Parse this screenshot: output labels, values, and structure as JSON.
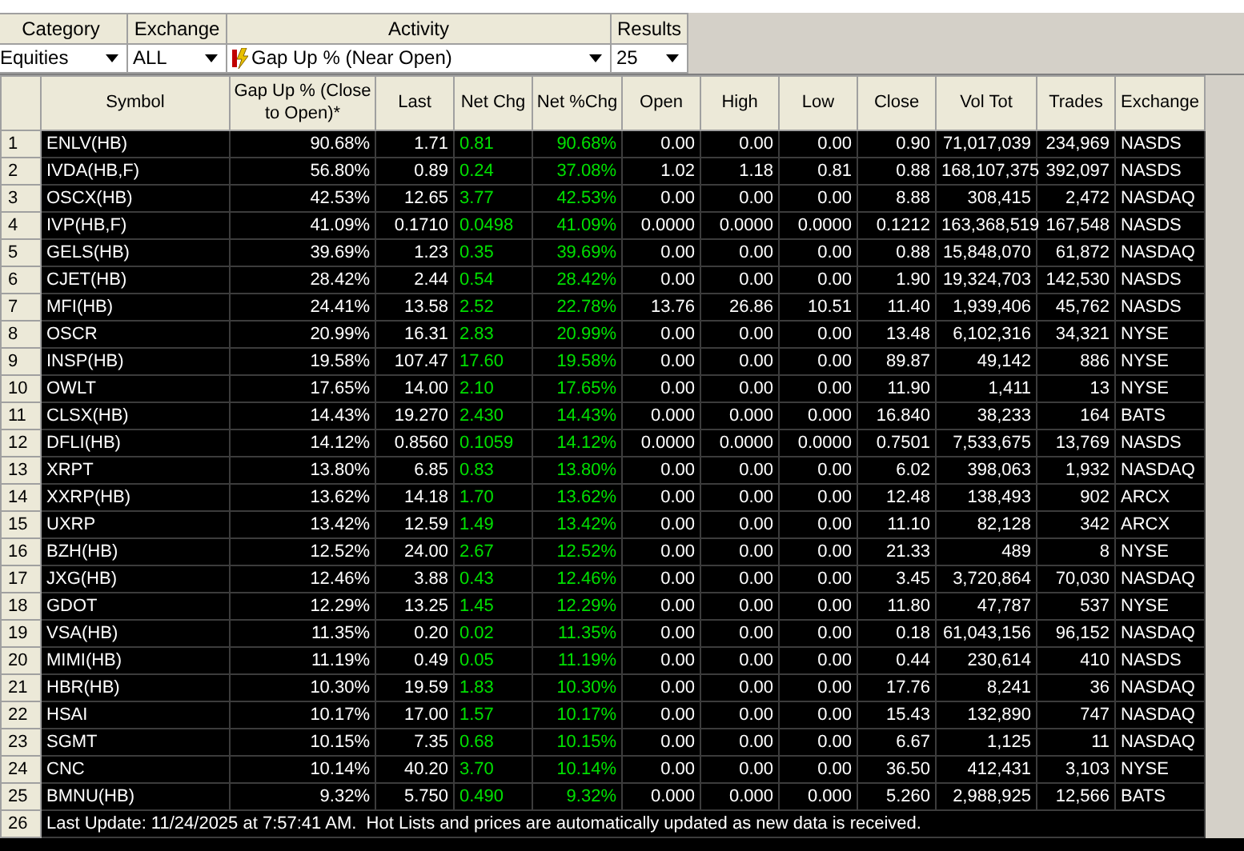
{
  "filters": [
    {
      "label": "Category",
      "value": "Equities",
      "icon": false
    },
    {
      "label": "Exchange",
      "value": "ALL",
      "icon": false
    },
    {
      "label": "Activity",
      "value": "Gap Up % (Near Open)",
      "icon": true
    },
    {
      "label": "Results",
      "value": "25",
      "icon": false
    }
  ],
  "table": {
    "columns": [
      "",
      "Symbol",
      "Gap Up % (Close to Open)*",
      "Last",
      "Net Chg",
      "Net %Chg",
      "Open",
      "High",
      "Low",
      "Close",
      "Vol Tot",
      "Trades",
      "Exchange"
    ],
    "rows": [
      [
        "1",
        "ENLV(HB)",
        "90.68%",
        "1.71",
        "0.81",
        "90.68%",
        "0.00",
        "0.00",
        "0.00",
        "0.90",
        "71,017,039",
        "234,969",
        "NASDS"
      ],
      [
        "2",
        "IVDA(HB,F)",
        "56.80%",
        "0.89",
        "0.24",
        "37.08%",
        "1.02",
        "1.18",
        "0.81",
        "0.88",
        "168,107,375",
        "392,097",
        "NASDS"
      ],
      [
        "3",
        "OSCX(HB)",
        "42.53%",
        "12.65",
        "3.77",
        "42.53%",
        "0.00",
        "0.00",
        "0.00",
        "8.88",
        "308,415",
        "2,472",
        "NASDAQ"
      ],
      [
        "4",
        "IVP(HB,F)",
        "41.09%",
        "0.1710",
        "0.0498",
        "41.09%",
        "0.0000",
        "0.0000",
        "0.0000",
        "0.1212",
        "163,368,519",
        "167,548",
        "NASDS"
      ],
      [
        "5",
        "GELS(HB)",
        "39.69%",
        "1.23",
        "0.35",
        "39.69%",
        "0.00",
        "0.00",
        "0.00",
        "0.88",
        "15,848,070",
        "61,872",
        "NASDAQ"
      ],
      [
        "6",
        "CJET(HB)",
        "28.42%",
        "2.44",
        "0.54",
        "28.42%",
        "0.00",
        "0.00",
        "0.00",
        "1.90",
        "19,324,703",
        "142,530",
        "NASDS"
      ],
      [
        "7",
        "MFI(HB)",
        "24.41%",
        "13.58",
        "2.52",
        "22.78%",
        "13.76",
        "26.86",
        "10.51",
        "11.40",
        "1,939,406",
        "45,762",
        "NASDS"
      ],
      [
        "8",
        "OSCR",
        "20.99%",
        "16.31",
        "2.83",
        "20.99%",
        "0.00",
        "0.00",
        "0.00",
        "13.48",
        "6,102,316",
        "34,321",
        "NYSE"
      ],
      [
        "9",
        "INSP(HB)",
        "19.58%",
        "107.47",
        "17.60",
        "19.58%",
        "0.00",
        "0.00",
        "0.00",
        "89.87",
        "49,142",
        "886",
        "NYSE"
      ],
      [
        "10",
        "OWLT",
        "17.65%",
        "14.00",
        "2.10",
        "17.65%",
        "0.00",
        "0.00",
        "0.00",
        "11.90",
        "1,411",
        "13",
        "NYSE"
      ],
      [
        "11",
        "CLSX(HB)",
        "14.43%",
        "19.270",
        "2.430",
        "14.43%",
        "0.000",
        "0.000",
        "0.000",
        "16.840",
        "38,233",
        "164",
        "BATS"
      ],
      [
        "12",
        "DFLI(HB)",
        "14.12%",
        "0.8560",
        "0.1059",
        "14.12%",
        "0.0000",
        "0.0000",
        "0.0000",
        "0.7501",
        "7,533,675",
        "13,769",
        "NASDS"
      ],
      [
        "13",
        "XRPT",
        "13.80%",
        "6.85",
        "0.83",
        "13.80%",
        "0.00",
        "0.00",
        "0.00",
        "6.02",
        "398,063",
        "1,932",
        "NASDAQ"
      ],
      [
        "14",
        "XXRP(HB)",
        "13.62%",
        "14.18",
        "1.70",
        "13.62%",
        "0.00",
        "0.00",
        "0.00",
        "12.48",
        "138,493",
        "902",
        "ARCX"
      ],
      [
        "15",
        "UXRP",
        "13.42%",
        "12.59",
        "1.49",
        "13.42%",
        "0.00",
        "0.00",
        "0.00",
        "11.10",
        "82,128",
        "342",
        "ARCX"
      ],
      [
        "16",
        "BZH(HB)",
        "12.52%",
        "24.00",
        "2.67",
        "12.52%",
        "0.00",
        "0.00",
        "0.00",
        "21.33",
        "489",
        "8",
        "NYSE"
      ],
      [
        "17",
        "JXG(HB)",
        "12.46%",
        "3.88",
        "0.43",
        "12.46%",
        "0.00",
        "0.00",
        "0.00",
        "3.45",
        "3,720,864",
        "70,030",
        "NASDAQ"
      ],
      [
        "18",
        "GDOT",
        "12.29%",
        "13.25",
        "1.45",
        "12.29%",
        "0.00",
        "0.00",
        "0.00",
        "11.80",
        "47,787",
        "537",
        "NYSE"
      ],
      [
        "19",
        "VSA(HB)",
        "11.35%",
        "0.20",
        "0.02",
        "11.35%",
        "0.00",
        "0.00",
        "0.00",
        "0.18",
        "61,043,156",
        "96,152",
        "NASDAQ"
      ],
      [
        "20",
        "MIMI(HB)",
        "11.19%",
        "0.49",
        "0.05",
        "11.19%",
        "0.00",
        "0.00",
        "0.00",
        "0.44",
        "230,614",
        "410",
        "NASDS"
      ],
      [
        "21",
        "HBR(HB)",
        "10.30%",
        "19.59",
        "1.83",
        "10.30%",
        "0.00",
        "0.00",
        "0.00",
        "17.76",
        "8,241",
        "36",
        "NASDAQ"
      ],
      [
        "22",
        "HSAI",
        "10.17%",
        "17.00",
        "1.57",
        "10.17%",
        "0.00",
        "0.00",
        "0.00",
        "15.43",
        "132,890",
        "747",
        "NASDAQ"
      ],
      [
        "23",
        "SGMT",
        "10.15%",
        "7.35",
        "0.68",
        "10.15%",
        "0.00",
        "0.00",
        "0.00",
        "6.67",
        "1,125",
        "11",
        "NASDAQ"
      ],
      [
        "24",
        "CNC",
        "10.14%",
        "40.20",
        "3.70",
        "10.14%",
        "0.00",
        "0.00",
        "0.00",
        "36.50",
        "412,431",
        "3,103",
        "NYSE"
      ],
      [
        "25",
        "BMNU(HB)",
        "9.32%",
        "5.750",
        "0.490",
        "9.32%",
        "0.000",
        "0.000",
        "0.000",
        "5.260",
        "2,988,925",
        "12,566",
        "BATS"
      ]
    ]
  },
  "status_bar": {
    "row_number": "26",
    "text": "Last Update: 11/24/2025 at 7:57:41 AM.  Hot Lists and prices are automatically updated as new data is received."
  }
}
